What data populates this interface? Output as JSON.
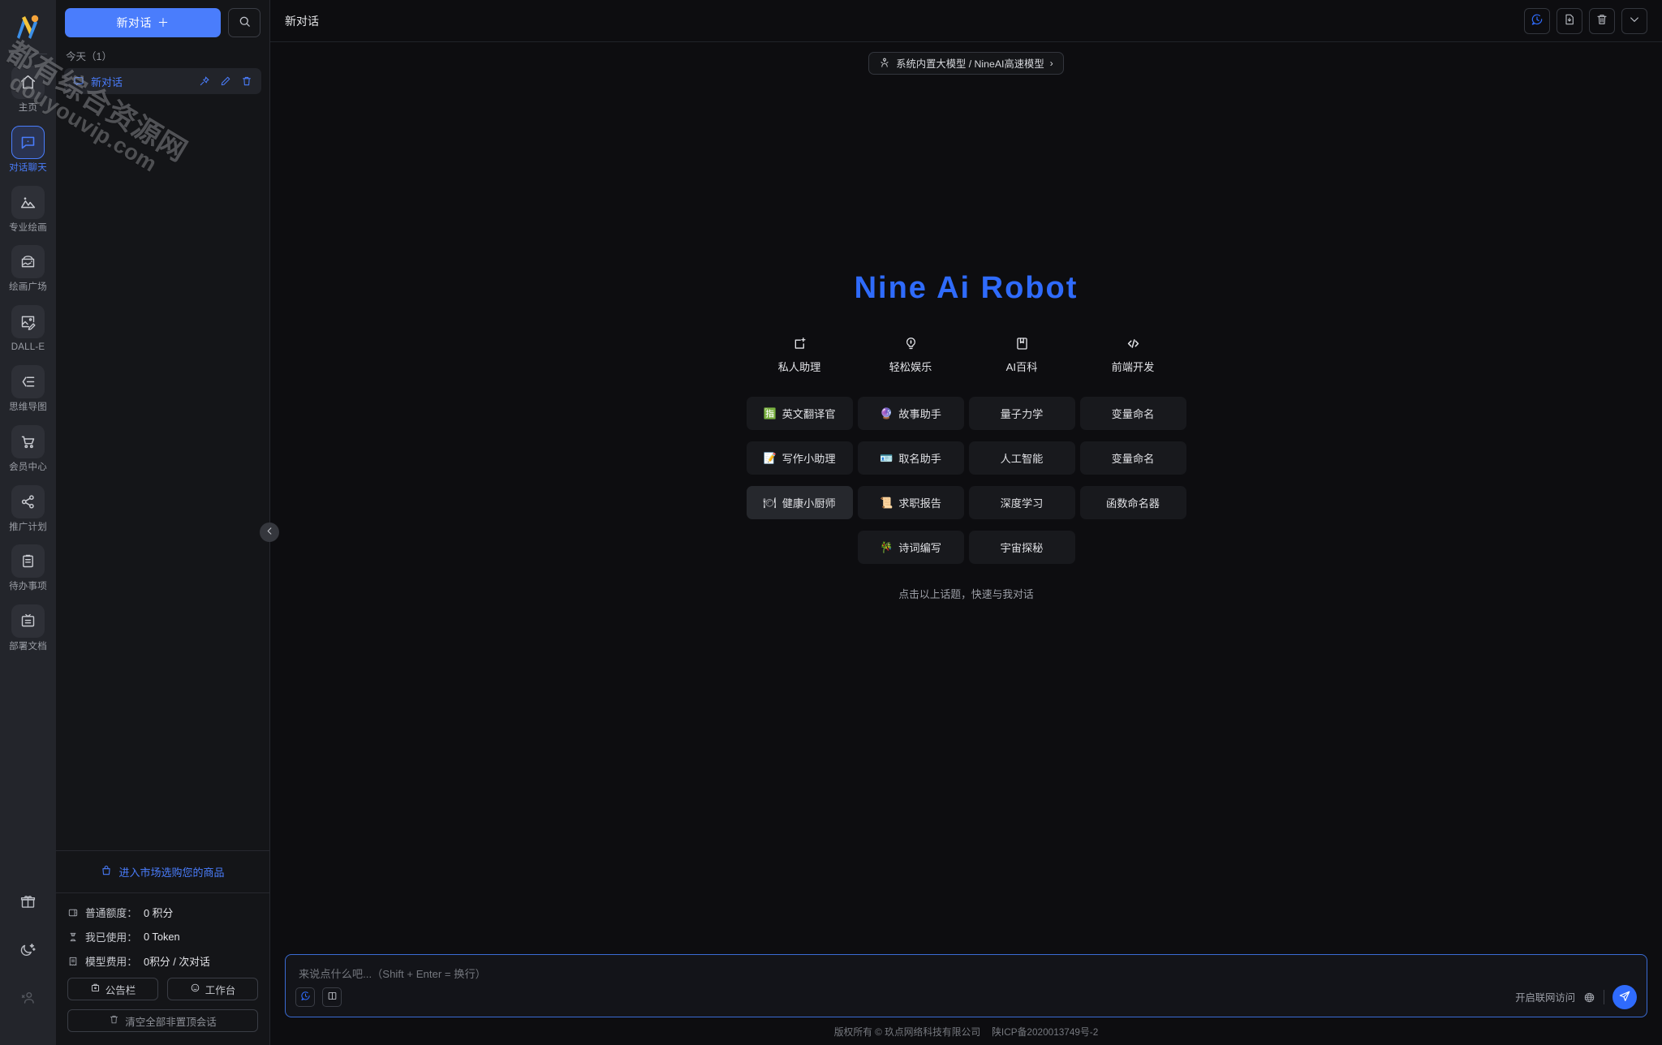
{
  "brand": {
    "logo_alt": "nine-ai-logo",
    "accent": "#4a7dfc"
  },
  "watermark": {
    "line1": "都有综合资源网",
    "line2": "douyouvip.com"
  },
  "rail": {
    "items": [
      {
        "label": "主页",
        "icon": "home-icon",
        "active": false
      },
      {
        "label": "对话聊天",
        "icon": "chat-bubble-icon",
        "active": true
      },
      {
        "label": "专业绘画",
        "icon": "image-mountain-icon",
        "active": false
      },
      {
        "label": "绘画广场",
        "icon": "gallery-icon",
        "active": false
      },
      {
        "label": "DALL-E",
        "icon": "picture-pen-icon",
        "active": false
      },
      {
        "label": "思维导图",
        "icon": "mindmap-icon",
        "active": false
      },
      {
        "label": "会员中心",
        "icon": "shopping-cart-icon",
        "active": false
      },
      {
        "label": "推广计划",
        "icon": "share-nodes-icon",
        "active": false
      },
      {
        "label": "待办事项",
        "icon": "clipboard-icon",
        "active": false
      },
      {
        "label": "部署文档",
        "icon": "document-archive-icon",
        "active": false
      }
    ],
    "bottom": [
      {
        "icon": "gift-icon",
        "name": "gift-button"
      },
      {
        "icon": "moon-stars-icon",
        "name": "theme-toggle-button"
      },
      {
        "icon": "add-user-icon",
        "name": "login-button"
      }
    ]
  },
  "sidebar": {
    "new_chat_label": "新对话",
    "new_chat_plus": "＋",
    "search_icon": "search-icon",
    "group_label": "今天（1）",
    "conversations": [
      {
        "title": "新对话",
        "icon": "chat-square-icon",
        "actions": [
          "pin-icon",
          "edit-icon",
          "delete-icon"
        ]
      }
    ],
    "market_link": "进入市场选购您的商品",
    "stats": [
      {
        "icon": "wallet-icon",
        "label": "普通额度：",
        "value": "0 积分"
      },
      {
        "icon": "hourglass-icon",
        "label": "我已使用：",
        "value": "0 Token"
      },
      {
        "icon": "receipt-icon",
        "label": "模型费用：",
        "value": "0积分 / 次对话"
      }
    ],
    "buttons": [
      {
        "label": "公告栏",
        "icon": "megaphone-icon"
      },
      {
        "label": "工作台",
        "icon": "workbench-icon"
      }
    ],
    "clear_label": "清空全部非置顶会话",
    "clear_icon": "trash-icon",
    "collapse_icon": "chevron-left-icon"
  },
  "header": {
    "title": "新对话",
    "actions": [
      {
        "name": "history-button",
        "icon": "chat-history-icon",
        "accent": true
      },
      {
        "name": "save-button",
        "icon": "file-download-icon",
        "accent": false
      },
      {
        "name": "clear-button",
        "icon": "trash-icon",
        "accent": false
      },
      {
        "name": "more-button",
        "icon": "chevron-down-icon",
        "accent": false
      }
    ]
  },
  "model": {
    "icon": "model-robot-icon",
    "label": "系统内置大模型 / NineAI高速模型",
    "chevron": "›"
  },
  "welcome": {
    "title": "Nine Ai Robot",
    "categories": [
      {
        "label": "私人助理",
        "icon": "assistant-sparkle-icon"
      },
      {
        "label": "轻松娱乐",
        "icon": "lightbulb-pin-icon"
      },
      {
        "label": "AI百科",
        "icon": "book-bookmark-icon"
      },
      {
        "label": "前端开发",
        "icon": "code-brackets-icon"
      }
    ],
    "columns": [
      {
        "cards": [
          {
            "label": "英文翻译官",
            "emoji": "🈯",
            "highlight": false
          },
          {
            "label": "写作小助理",
            "emoji": "📝",
            "highlight": false
          },
          {
            "label": "健康小厨师",
            "emoji": "🍽",
            "highlight": true
          }
        ]
      },
      {
        "cards": [
          {
            "label": "故事助手",
            "emoji": "🔮",
            "highlight": false
          },
          {
            "label": "取名助手",
            "emoji": "🪪",
            "highlight": false
          },
          {
            "label": "求职报告",
            "emoji": "📜",
            "highlight": false
          },
          {
            "label": "诗词编写",
            "emoji": "🎋",
            "highlight": false
          }
        ]
      },
      {
        "cards": [
          {
            "label": "量子力学",
            "emoji": "",
            "highlight": false
          },
          {
            "label": "人工智能",
            "emoji": "",
            "highlight": false
          },
          {
            "label": "深度学习",
            "emoji": "",
            "highlight": false
          },
          {
            "label": "宇宙探秘",
            "emoji": "",
            "highlight": false
          }
        ]
      },
      {
        "cards": [
          {
            "label": "变量命名",
            "emoji": "",
            "highlight": false
          },
          {
            "label": "变量命名",
            "emoji": "",
            "highlight": false
          },
          {
            "label": "函数命名器",
            "emoji": "",
            "highlight": false
          }
        ]
      }
    ],
    "hint": "点击以上话题，快速与我对话"
  },
  "composer": {
    "placeholder": "来说点什么吧...（Shift + Enter = 换行）",
    "value": "",
    "left_buttons": [
      {
        "name": "prompt-history-button",
        "icon": "chat-history-icon",
        "accent": true
      },
      {
        "name": "split-view-button",
        "icon": "columns-icon",
        "accent": false
      }
    ],
    "net_label": "开启联网访问",
    "globe_icon": "globe-icon",
    "send_icon": "send-icon"
  },
  "footer": {
    "copyright": "版权所有 © 玖点网络科技有限公司",
    "icp": "陕ICP备2020013749号-2"
  }
}
